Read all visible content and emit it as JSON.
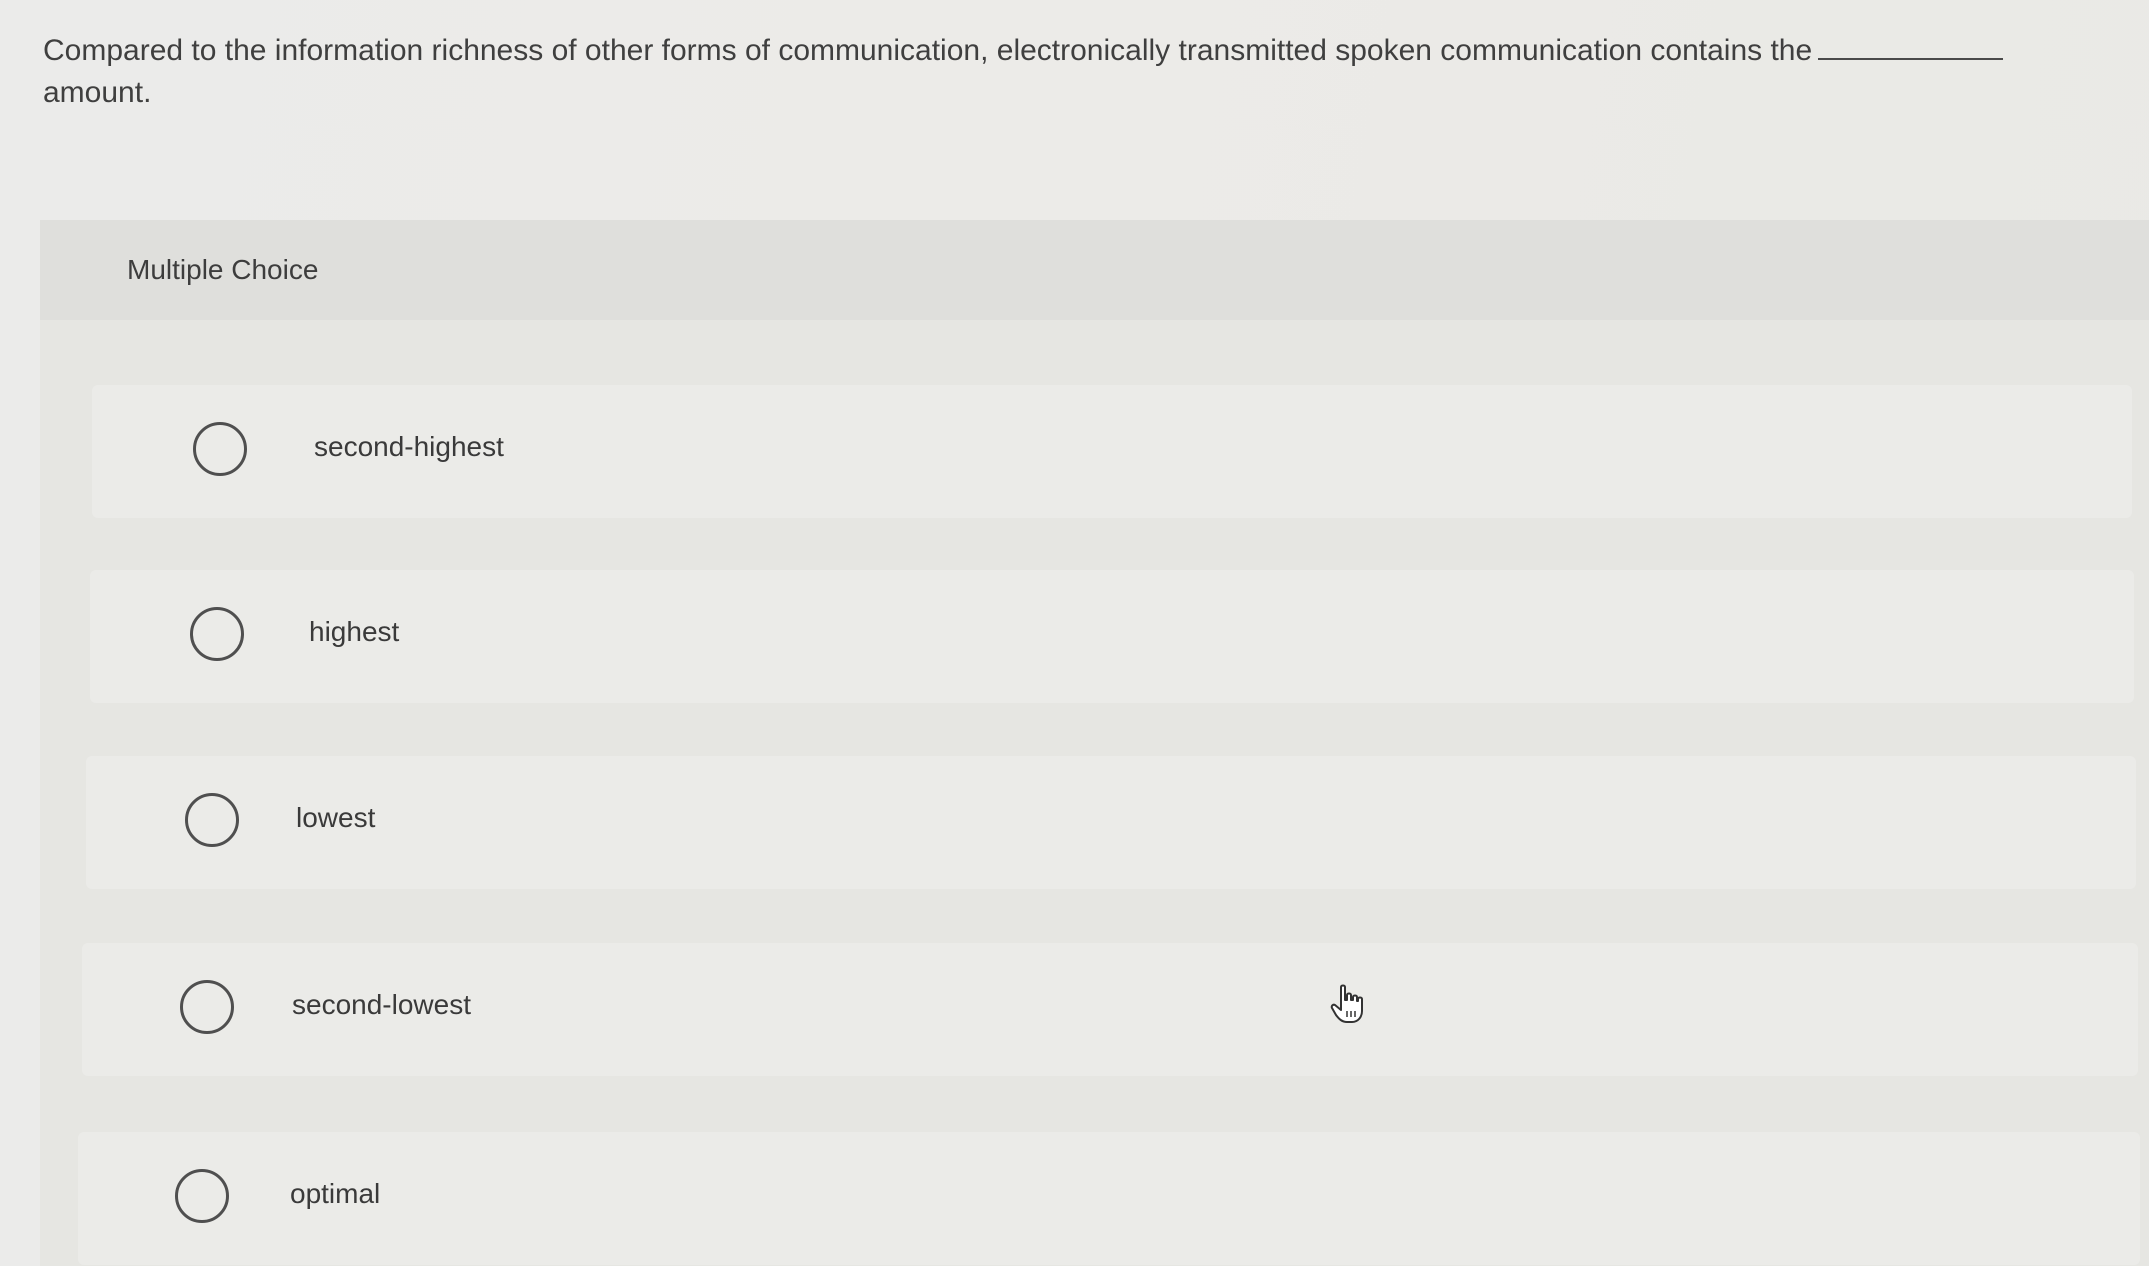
{
  "question": {
    "text": "Compared to the information richness of other forms of communication, electronically transmitted spoken communication contains the",
    "text_after_blank": "amount."
  },
  "panel": {
    "header_label": "Multiple Choice"
  },
  "options": [
    {
      "label": "second-highest",
      "selected": false
    },
    {
      "label": "highest",
      "selected": false
    },
    {
      "label": "lowest",
      "selected": false
    },
    {
      "label": "second-lowest",
      "selected": false
    },
    {
      "label": "optimal",
      "selected": false
    }
  ],
  "cursor": {
    "icon": "hand-pointer-icon"
  }
}
